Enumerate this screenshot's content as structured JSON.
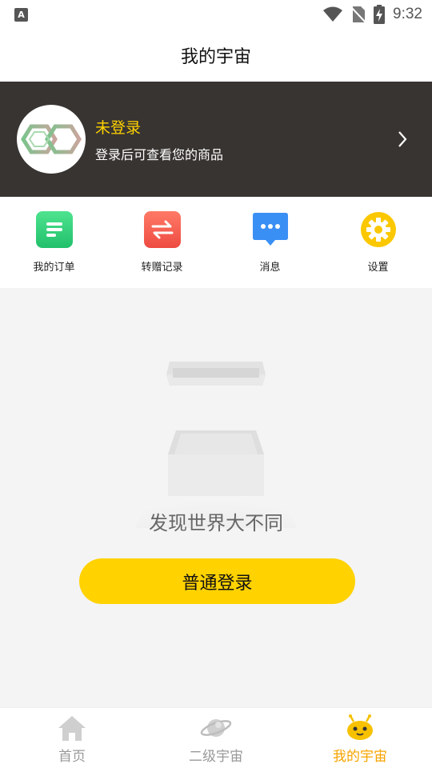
{
  "status_bar": {
    "time": "9:32",
    "notification_icon_letter": "A",
    "icons": [
      "wifi-icon",
      "no-sim-icon",
      "battery-charging-icon"
    ]
  },
  "header": {
    "title": "我的宇宙"
  },
  "profile": {
    "status": "未登录",
    "hint": "登录后可查看您的商品",
    "avatar_icon": "infinity-logo-icon",
    "arrow_icon": "chevron-right-icon"
  },
  "quick_menu": {
    "items": [
      {
        "label": "我的订单",
        "icon": "order-list-icon",
        "color": "#2fd07a"
      },
      {
        "label": "转赠记录",
        "icon": "transfer-icon",
        "color": "#f2574a"
      },
      {
        "label": "消息",
        "icon": "message-icon",
        "color": "#3a8ff5"
      },
      {
        "label": "设置",
        "icon": "gear-icon",
        "color": "#fbc800"
      }
    ]
  },
  "empty_state": {
    "illustration": "empty-box-icon",
    "text": "发现世界大不同",
    "button_label": "普通登录"
  },
  "tab_bar": {
    "tabs": [
      {
        "label": "首页",
        "icon": "home-icon",
        "active": false
      },
      {
        "label": "二级宇宙",
        "icon": "planet-icon",
        "active": false
      },
      {
        "label": "我的宇宙",
        "icon": "mascot-icon",
        "active": true
      }
    ]
  },
  "colors": {
    "accent": "#ffd200",
    "active_tab": "#f7a400",
    "profile_bg": "#383431",
    "page_bg": "#f4f4f4"
  }
}
